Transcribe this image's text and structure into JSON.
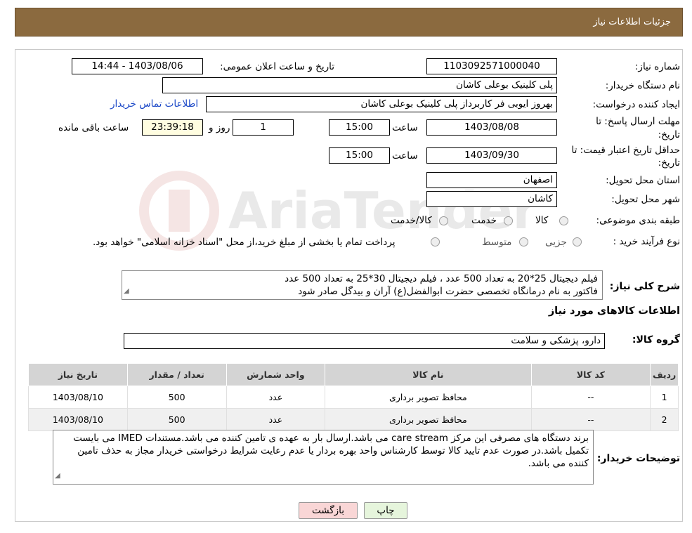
{
  "header": {
    "title": "جزئیات اطلاعات نیاز"
  },
  "form": {
    "need_number_label": "شماره نیاز:",
    "need_number": "1103092571000040",
    "announce_label": "تاریخ و ساعت اعلان عمومی:",
    "announce_value": "1403/08/06 - 14:44",
    "buyer_org_label": "نام دستگاه خریدار:",
    "buyer_org": "پلی کلینیک بوعلی کاشان",
    "creator_label": "ایجاد کننده درخواست:",
    "creator": "بهروز ایوبی فر کاربرداز پلی کلینیک بوعلی کاشان",
    "contact_link": "اطلاعات تماس خریدار",
    "deadline_label": "مهلت ارسال پاسخ: تا",
    "deadline_label2": "تاریخ:",
    "deadline_date": "1403/08/08",
    "time_label": "ساعت",
    "deadline_time": "15:00",
    "days": "1",
    "days_label": "روز و",
    "remaining": "23:39:18",
    "remaining_label": "ساعت باقی مانده",
    "validity_label": "حداقل تاریخ اعتبار قیمت: تا",
    "validity_label2": "تاریخ:",
    "validity_date": "1403/09/30",
    "validity_time": "15:00",
    "province_label": "استان محل تحویل:",
    "province": "اصفهان",
    "city_label": "شهر محل تحویل:",
    "city": "کاشان",
    "category_label": "طبقه بندی موضوعی:",
    "category_options": [
      "کالا",
      "خدمت",
      "کالا/خدمت"
    ],
    "process_label": "نوع فرآیند خرید :",
    "process_options": [
      "جزیی",
      "متوسط"
    ],
    "process_note": "پرداخت تمام یا بخشی از مبلغ خرید،از محل \"اسناد خزانه اسلامی\" خواهد بود."
  },
  "description": {
    "label": "شرح کلی نیاز:",
    "line1": "فیلم دیجیتال 25*20 به تعداد 500 عدد ، فیلم دیجیتال 30*25  به تعداد 500 عدد",
    "line2": "فاکتور به نام درمانگاه تخصصی حضرت ابوالفضل(ع) آران و بیدگل صادر شود"
  },
  "goods": {
    "section_title": "اطلاعات کالاهای مورد نیاز",
    "group_label": "گروه کالا:",
    "group_value": "دارو، پزشکی و سلامت",
    "columns": [
      "ردیف",
      "کد کالا",
      "نام کالا",
      "واحد شمارش",
      "تعداد / مقدار",
      "تاریخ نیاز"
    ],
    "rows": [
      {
        "row": "1",
        "code": "--",
        "name": "محافظ تصویر برداری",
        "unit": "عدد",
        "qty": "500",
        "date": "1403/08/10"
      },
      {
        "row": "2",
        "code": "--",
        "name": "محافظ تصویر برداری",
        "unit": "عدد",
        "qty": "500",
        "date": "1403/08/10"
      }
    ]
  },
  "buyer_notes": {
    "label": "توضیحات خریدار:",
    "text": "برند دستگاه های مصرفی این مرکز care stream  می باشد.ارسال بار به عهده ی تامین کننده می باشد.مستندات IMED می بایست تکمیل باشد.در صورت عدم تایید کالا توسط کارشناس واحد بهره بردار یا عدم رعایت شرایط درخواستی خریدار مجاز به حذف تامین کننده می باشد."
  },
  "buttons": {
    "print": "چاپ",
    "back": "بازگشت"
  },
  "watermark_text": "AriaTender.neT",
  "colors": {
    "header": "#8b6a3f",
    "link": "#1a47c7",
    "print_btn": "#e6f5dc",
    "back_btn": "#f9d6d6"
  }
}
